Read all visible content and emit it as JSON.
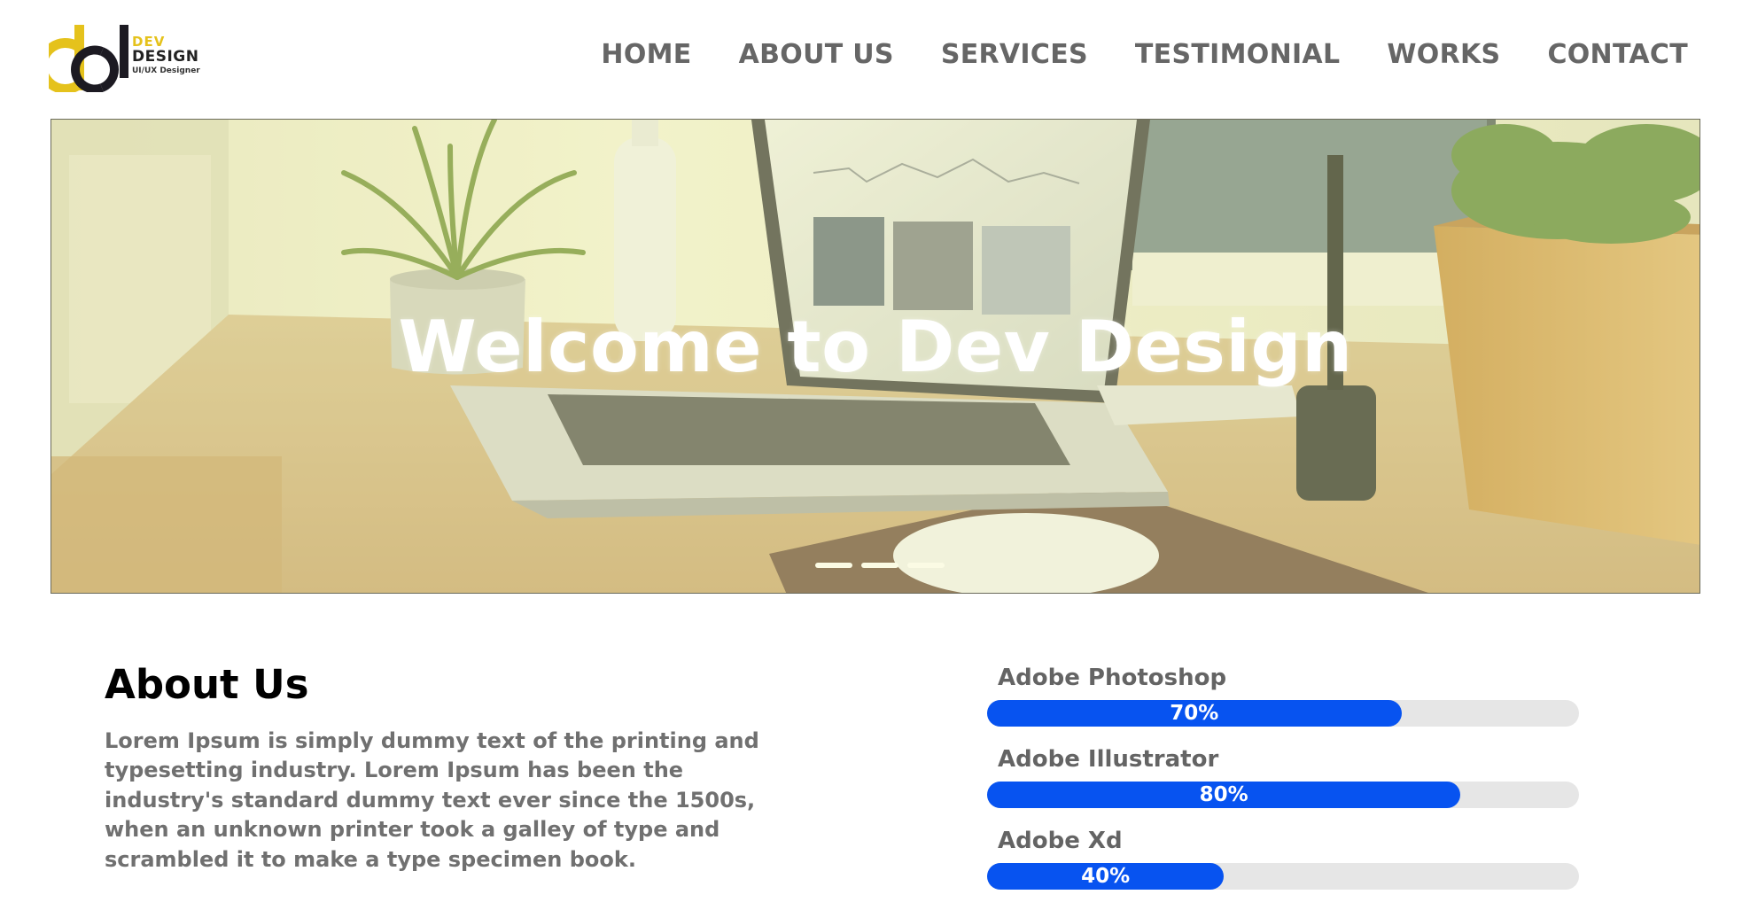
{
  "brand": {
    "logo_line1": "DEV",
    "logo_line2": "DESIGN",
    "logo_tagline": "UI/UX Designer",
    "colors": {
      "yellow": "#e5c21c",
      "dark": "#1c1a22"
    }
  },
  "nav": {
    "items": [
      {
        "label": "HOME"
      },
      {
        "label": "ABOUT US"
      },
      {
        "label": "SERVICES"
      },
      {
        "label": "TESTIMONIAL"
      },
      {
        "label": "WORKS"
      },
      {
        "label": "CONTACT"
      }
    ],
    "color": "#666666"
  },
  "hero": {
    "title": "Welcome to Dev Design",
    "slide_count": 3,
    "active_slide": 1,
    "image_description_icons": "desk-laptop-photo",
    "overlay_color": "#eceeaa"
  },
  "about": {
    "title": "About Us",
    "text": "Lorem Ipsum is simply dummy text of the printing and typesetting industry. Lorem Ipsum has been the industry's standard dummy text ever since the 1500s, when an unknown printer took a galley of type and scrambled it to make a type specimen book."
  },
  "skills": [
    {
      "name": "Adobe Photoshop",
      "percent_label": "70%",
      "value": 70
    },
    {
      "name": "Adobe Illustrator",
      "percent_label": "80%",
      "value": 80
    },
    {
      "name": "Adobe Xd",
      "percent_label": "40%",
      "value": 40
    }
  ],
  "skill_bar_color": "#0753f0"
}
